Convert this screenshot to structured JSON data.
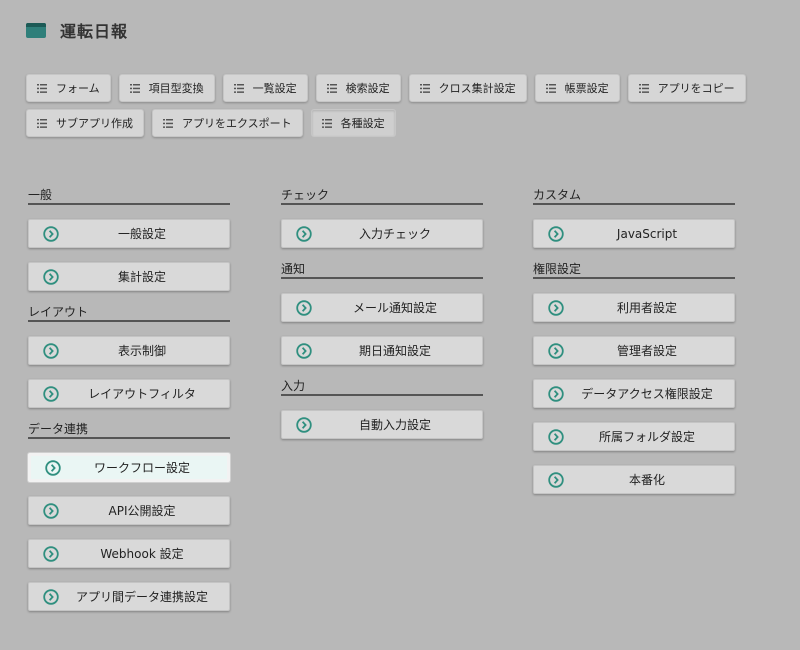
{
  "app": {
    "title": "運転日報",
    "accent": "#2f7f7a"
  },
  "toolbar": {
    "items": [
      {
        "label": "フォーム"
      },
      {
        "label": "項目型変換"
      },
      {
        "label": "一覧設定"
      },
      {
        "label": "検索設定"
      },
      {
        "label": "クロス集計設定"
      },
      {
        "label": "帳票設定"
      },
      {
        "label": "アプリをコピー"
      },
      {
        "label": "サブアプリ作成"
      },
      {
        "label": "アプリをエクスポート"
      },
      {
        "label": "各種設定"
      }
    ]
  },
  "sections": {
    "general": {
      "title": "一般",
      "items": [
        "一般設定",
        "集計設定"
      ]
    },
    "layout": {
      "title": "レイアウト",
      "items": [
        "表示制御",
        "レイアウトフィルタ"
      ]
    },
    "data_link": {
      "title": "データ連携",
      "items": [
        "ワークフロー設定",
        "API公開設定",
        "Webhook 設定",
        "アプリ間データ連携設定"
      ]
    },
    "check": {
      "title": "チェック",
      "items": [
        "入力チェック"
      ]
    },
    "notify": {
      "title": "通知",
      "items": [
        "メール通知設定",
        "期日通知設定"
      ]
    },
    "input": {
      "title": "入力",
      "items": [
        "自動入力設定"
      ]
    },
    "custom": {
      "title": "カスタム",
      "items": [
        "JavaScript"
      ]
    },
    "permission": {
      "title": "権限設定",
      "items": [
        "利用者設定",
        "管理者設定",
        "データアクセス権限設定",
        "所属フォルダ設定",
        "本番化"
      ]
    }
  }
}
